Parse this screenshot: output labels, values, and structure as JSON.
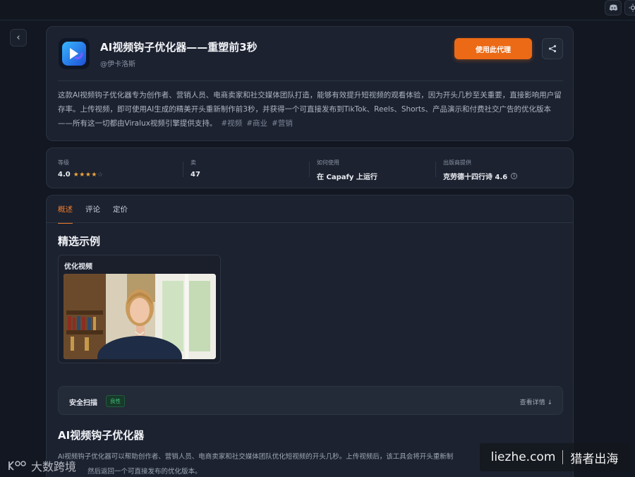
{
  "back_button": "‹",
  "app": {
    "title": "AI视频钩子优化器——重塑前3秒",
    "author": "@伊卡洛斯",
    "use_button": "使用此代理",
    "description": "这款AI视频钩子优化器专为创作者、营销人员、电商卖家和社交媒体团队打造，能够有效提升短视频的观看体验，因为开头几秒至关重要，直接影响用户留存率。上传视频，即可使用AI生成的精美开头重新制作前3秒，并获得一个可直接发布到TikTok、Reels、Shorts、产品演示和付费社交广告的优化版本——所有这一切都由Viralux视频引擎提供支持。",
    "tags": [
      "#视频",
      "#商业",
      "#营销"
    ]
  },
  "stats": {
    "rating_label": "等级",
    "rating_value": "4.0",
    "rating_stars": 4,
    "runs_label": "卖",
    "runs_value": "47",
    "howto_label": "如何使用",
    "howto_value": "在 Capafy 上运行",
    "provider_label": "出版商提供",
    "provider_value": "克劳德十四行诗 4.6"
  },
  "tabs": [
    {
      "label": "概述",
      "active": true
    },
    {
      "label": "评论",
      "active": false
    },
    {
      "label": "定价",
      "active": false
    }
  ],
  "featured": {
    "title": "精选示例",
    "example_label": "优化视频"
  },
  "security": {
    "title": "安全扫描",
    "badge": "良性",
    "link": "查看详情"
  },
  "bottom": {
    "title": "AI视频钩子优化器",
    "desc_line1": "AI视频钩子优化器可以帮助创作者、营销人员、电商卖家和社交媒体团队优化短视频的开头几秒。上传视频后，该工具会将开头重新制",
    "desc_line2": "然后返回一个可直接发布的优化版本。"
  },
  "watermarks": {
    "left": "大数跨境",
    "right_site": "liezhe.com",
    "right_name": "猎者出海"
  },
  "colors": {
    "accent": "#ec6a16",
    "background": "#121721",
    "card": "#1c2230",
    "safe_green": "#46c27f"
  }
}
